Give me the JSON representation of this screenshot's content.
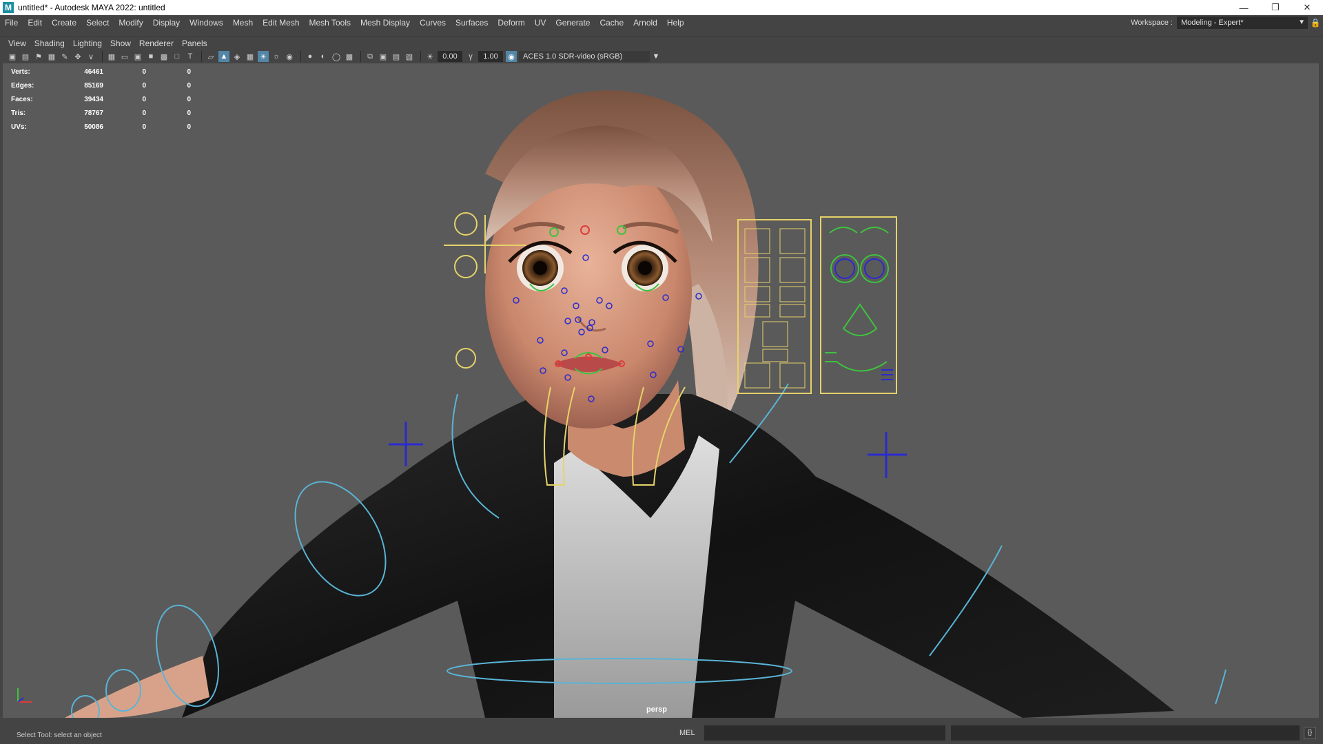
{
  "window": {
    "title": "untitled* - Autodesk MAYA 2022: untitled",
    "app_icon": "maya-icon",
    "controls": [
      "minimize-icon",
      "restore-icon",
      "close-icon"
    ]
  },
  "menubar": {
    "items": [
      "File",
      "Edit",
      "Create",
      "Select",
      "Modify",
      "Display",
      "Windows",
      "Mesh",
      "Edit Mesh",
      "Mesh Tools",
      "Mesh Display",
      "Curves",
      "Surfaces",
      "Deform",
      "UV",
      "Generate",
      "Cache",
      "Arnold",
      "Help"
    ],
    "workspace_label": "Workspace :",
    "workspace_value": "Modeling - Expert*"
  },
  "panel_menu": {
    "items": [
      "View",
      "Shading",
      "Lighting",
      "Show",
      "Renderer",
      "Panels"
    ]
  },
  "toolbar": {
    "exposure_value": "0.00",
    "gamma_value": "1.00",
    "color_space": "ACES 1.0 SDR-video (sRGB)"
  },
  "hud": {
    "rows": [
      {
        "label": "Verts:",
        "v1": "46461",
        "v2": "0",
        "v3": "0"
      },
      {
        "label": "Edges:",
        "v1": "85169",
        "v2": "0",
        "v3": "0"
      },
      {
        "label": "Faces:",
        "v1": "39434",
        "v2": "0",
        "v3": "0"
      },
      {
        "label": "Tris:",
        "v1": "78767",
        "v2": "0",
        "v3": "0"
      },
      {
        "label": "UVs:",
        "v1": "50086",
        "v2": "0",
        "v3": "0"
      }
    ]
  },
  "viewport": {
    "camera_label": "persp",
    "background_color": "#5a5a5a"
  },
  "statusbar": {
    "help_text": "Select Tool: select an object",
    "mel_label": "MEL"
  },
  "colors": {
    "accent": "#5285a6",
    "curve_cyan": "#5ab4d6",
    "control_yellow": "#e6d36a",
    "control_green": "#3fc23f",
    "control_blue": "#2a2ad0",
    "control_red": "#e03a3a"
  }
}
